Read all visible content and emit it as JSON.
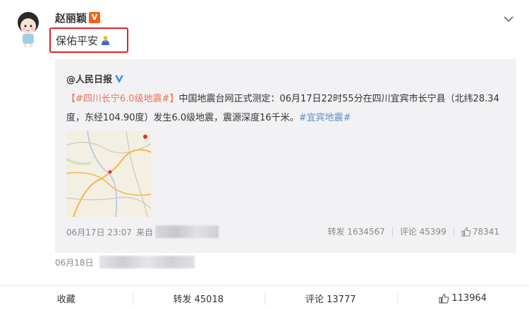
{
  "post": {
    "author": "赵丽颖",
    "verified_badge": "V",
    "text": "保佑平安",
    "text_emoji": "praying-icon",
    "time": "06月18日"
  },
  "repost": {
    "author": "@人民日报",
    "hashtag_1": "【#四川长宁6.0级地震#】",
    "body": "中国地震台网正式测定：06月17日22时55分在四川宜宾市长宁县（北纬28.34度，东经104.90度）发生6.0级地震，震源深度16千米。",
    "hashtag_2": "#宜宾地震#",
    "time": "06月17日 23:07",
    "source_prefix": "来自",
    "reposts_label": "转发 1634567",
    "comments_label": "评论 45399",
    "likes_count": "78341"
  },
  "actions": {
    "favorite": "收藏",
    "repost": "转发 45018",
    "comment": "评论 13777",
    "like": "113964"
  },
  "colors": {
    "accent_orange": "#eb7350",
    "highlight_red": "#e0232a",
    "blue_link": "#5d8ec4",
    "card_bg": "#f2f2f5"
  }
}
